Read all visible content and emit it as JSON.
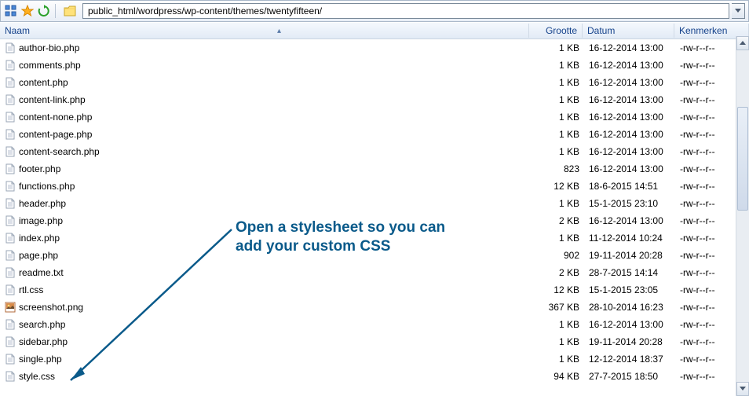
{
  "toolbar": {
    "path": "public_html/wordpress/wp-content/themes/twentyfifteen/"
  },
  "columns": {
    "name": "Naam",
    "size": "Grootte",
    "date": "Datum",
    "attr": "Kenmerken",
    "sort_indicator": "▴"
  },
  "files": [
    {
      "icon": "php",
      "name": "author-bio.php",
      "size": "1 KB",
      "date": "16-12-2014 13:00",
      "attr": "-rw-r--r--"
    },
    {
      "icon": "php",
      "name": "comments.php",
      "size": "1 KB",
      "date": "16-12-2014 13:00",
      "attr": "-rw-r--r--"
    },
    {
      "icon": "php",
      "name": "content.php",
      "size": "1 KB",
      "date": "16-12-2014 13:00",
      "attr": "-rw-r--r--"
    },
    {
      "icon": "php",
      "name": "content-link.php",
      "size": "1 KB",
      "date": "16-12-2014 13:00",
      "attr": "-rw-r--r--"
    },
    {
      "icon": "php",
      "name": "content-none.php",
      "size": "1 KB",
      "date": "16-12-2014 13:00",
      "attr": "-rw-r--r--"
    },
    {
      "icon": "php",
      "name": "content-page.php",
      "size": "1 KB",
      "date": "16-12-2014 13:00",
      "attr": "-rw-r--r--"
    },
    {
      "icon": "php",
      "name": "content-search.php",
      "size": "1 KB",
      "date": "16-12-2014 13:00",
      "attr": "-rw-r--r--"
    },
    {
      "icon": "php",
      "name": "footer.php",
      "size": "823",
      "date": "16-12-2014 13:00",
      "attr": "-rw-r--r--"
    },
    {
      "icon": "php",
      "name": "functions.php",
      "size": "12 KB",
      "date": "18-6-2015 14:51",
      "attr": "-rw-r--r--"
    },
    {
      "icon": "php",
      "name": "header.php",
      "size": "1 KB",
      "date": "15-1-2015 23:10",
      "attr": "-rw-r--r--"
    },
    {
      "icon": "php",
      "name": "image.php",
      "size": "2 KB",
      "date": "16-12-2014 13:00",
      "attr": "-rw-r--r--"
    },
    {
      "icon": "php",
      "name": "index.php",
      "size": "1 KB",
      "date": "11-12-2014 10:24",
      "attr": "-rw-r--r--"
    },
    {
      "icon": "php",
      "name": "page.php",
      "size": "902",
      "date": "19-11-2014 20:28",
      "attr": "-rw-r--r--"
    },
    {
      "icon": "txt",
      "name": "readme.txt",
      "size": "2 KB",
      "date": "28-7-2015 14:14",
      "attr": "-rw-r--r--"
    },
    {
      "icon": "css",
      "name": "rtl.css",
      "size": "12 KB",
      "date": "15-1-2015 23:05",
      "attr": "-rw-r--r--"
    },
    {
      "icon": "png",
      "name": "screenshot.png",
      "size": "367 KB",
      "date": "28-10-2014 16:23",
      "attr": "-rw-r--r--"
    },
    {
      "icon": "php",
      "name": "search.php",
      "size": "1 KB",
      "date": "16-12-2014 13:00",
      "attr": "-rw-r--r--"
    },
    {
      "icon": "php",
      "name": "sidebar.php",
      "size": "1 KB",
      "date": "19-11-2014 20:28",
      "attr": "-rw-r--r--"
    },
    {
      "icon": "php",
      "name": "single.php",
      "size": "1 KB",
      "date": "12-12-2014 18:37",
      "attr": "-rw-r--r--"
    },
    {
      "icon": "css",
      "name": "style.css",
      "size": "94 KB",
      "date": "27-7-2015 18:50",
      "attr": "-rw-r--r--"
    }
  ],
  "annotation": {
    "line1": "Open a stylesheet so you can",
    "line2": "add your custom CSS"
  }
}
